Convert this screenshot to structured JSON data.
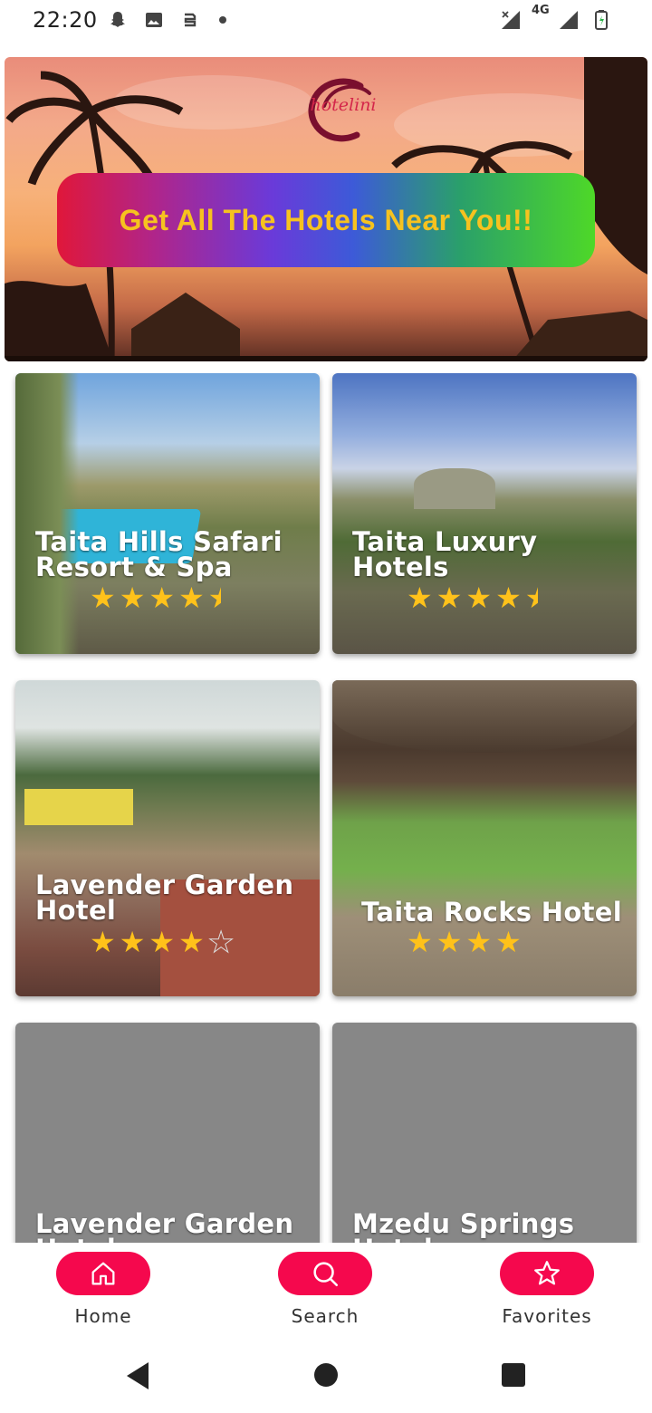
{
  "status_bar": {
    "time": "22:20",
    "network": "4G",
    "icons": [
      "snapchat-icon",
      "image-icon",
      "cloud-sync-icon",
      "dot-icon",
      "signal-off-icon",
      "signal-icon",
      "battery-icon"
    ]
  },
  "banner": {
    "logo_text": "hotelini",
    "cta_text": "Get All The Hotels Near You!!"
  },
  "hotels": [
    {
      "name": "Taita Hills Safari Resort & Spa",
      "rating": 4.5
    },
    {
      "name": "Taita Luxury Hotels",
      "rating": 4.5
    },
    {
      "name": "Lavender Garden Hotel",
      "rating": 4
    },
    {
      "name": "Taita Rocks Hotel",
      "rating": 4
    },
    {
      "name": "Lavender Garden Hotel",
      "rating": null
    },
    {
      "name": "Mzedu Springs Hotel",
      "rating": null
    }
  ],
  "bottom_nav": [
    {
      "label": "Home",
      "icon": "home-icon"
    },
    {
      "label": "Search",
      "icon": "search-icon"
    },
    {
      "label": "Favorites",
      "icon": "star-icon"
    }
  ],
  "colors": {
    "accent": "#f5084d",
    "star": "#ffc21a",
    "cta_text": "#f6c21f"
  }
}
